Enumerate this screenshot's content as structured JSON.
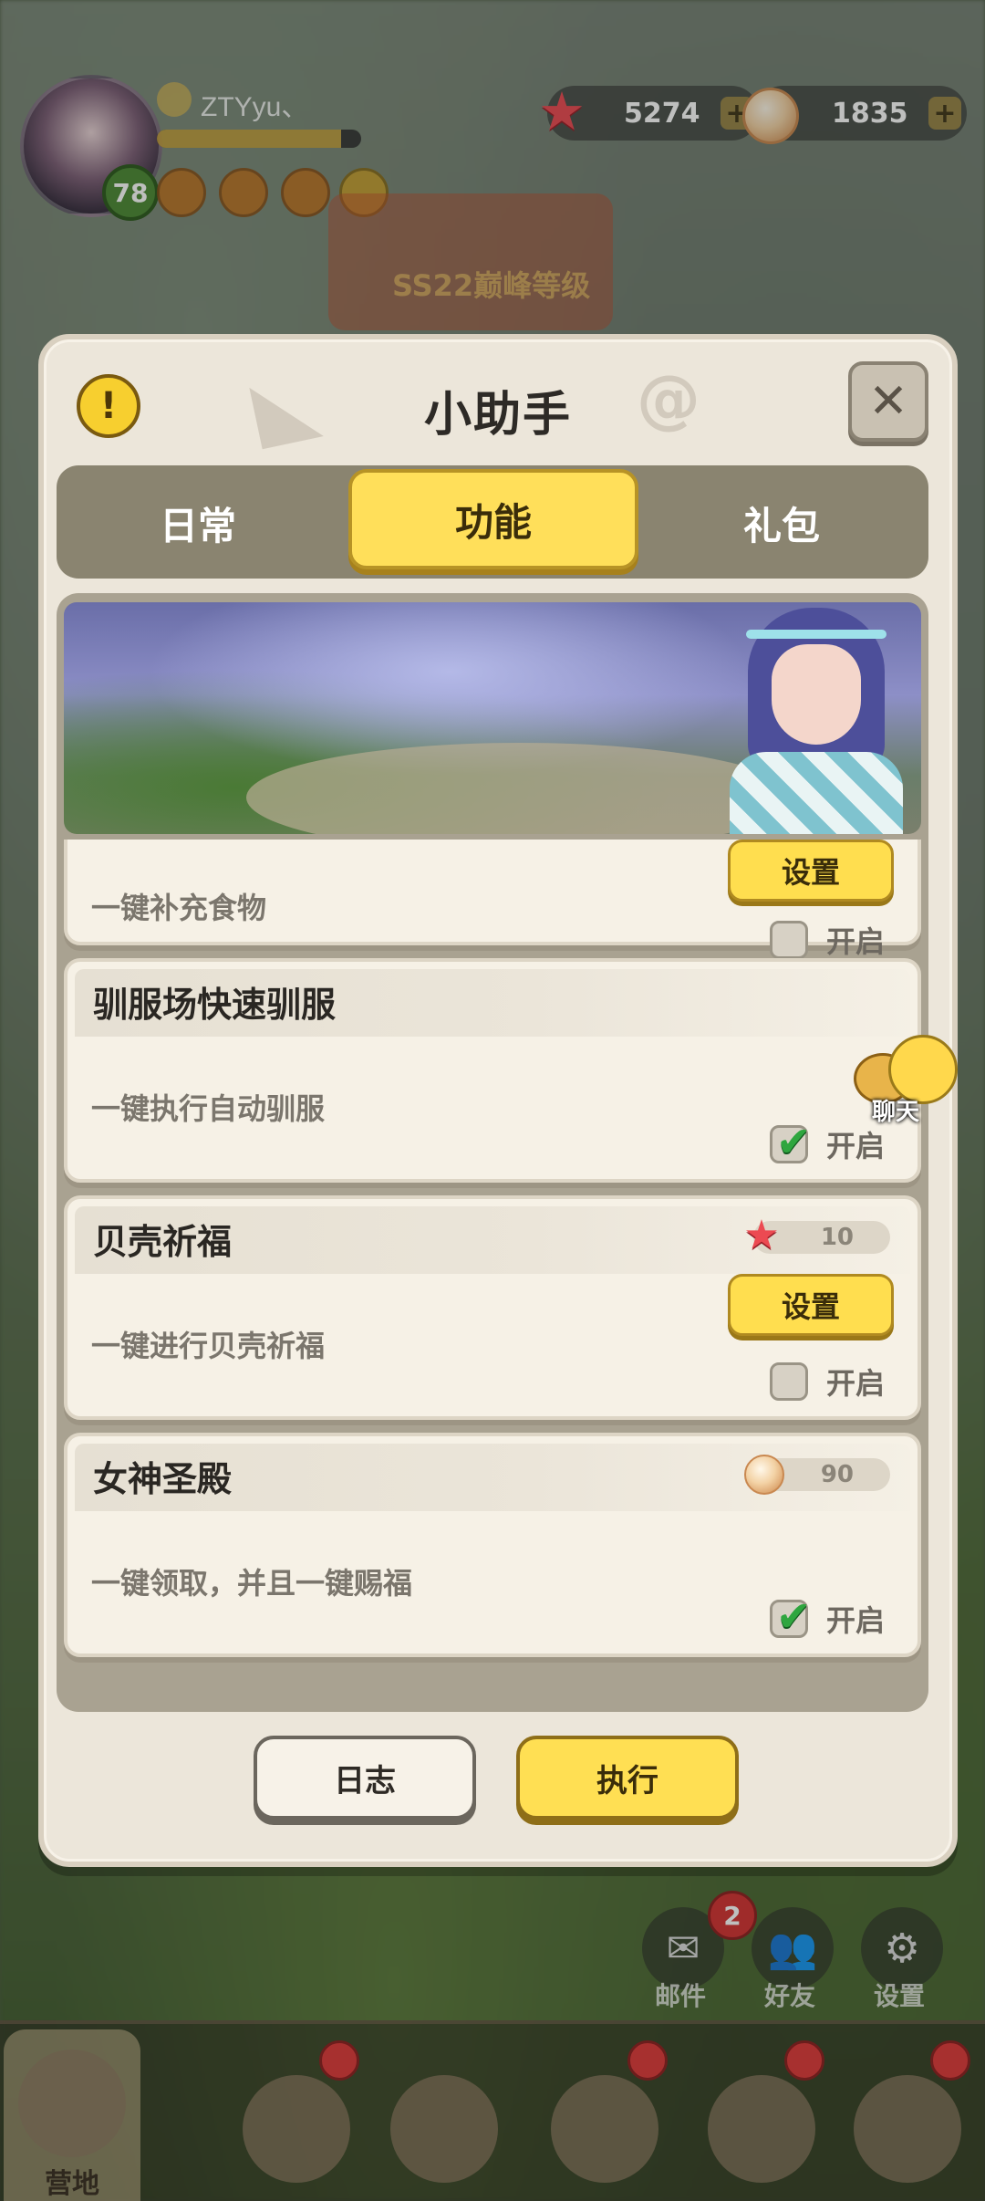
{
  "hud": {
    "username": "ZTYyu、",
    "level": "78",
    "xp_fraction": 0.9,
    "currencies": [
      {
        "icon": "starfish-icon",
        "value": "5274"
      },
      {
        "icon": "pearl-shell-icon",
        "value": "1835"
      }
    ]
  },
  "background": {
    "banner_text": "SS22巅峰等级",
    "mail_badge_count": "2",
    "side_buttons": [
      {
        "icon": "mail-icon",
        "label": "邮件"
      },
      {
        "icon": "friends-icon",
        "label": "好友"
      },
      {
        "icon": "gear-icon",
        "label": "设置"
      }
    ],
    "bottom_nav": [
      {
        "label": "营地",
        "active": true
      }
    ]
  },
  "dialog": {
    "title": "小助手",
    "tabs": [
      {
        "label": "日常",
        "active": false
      },
      {
        "label": "功能",
        "active": true
      },
      {
        "label": "礼包",
        "active": false
      }
    ],
    "cards": [
      {
        "title": "",
        "description": "一键补充食物",
        "setting_label": "设置",
        "toggle_label": "开启",
        "checked": false
      },
      {
        "title": "驯服场快速驯服",
        "description": "一键执行自动驯服",
        "toggle_label": "开启",
        "checked": true
      },
      {
        "title": "贝壳祈福",
        "cost_icon": "starfish-icon",
        "cost": "10",
        "description": "一键进行贝壳祈福",
        "setting_label": "设置",
        "toggle_label": "开启",
        "checked": false
      },
      {
        "title": "女神圣殿",
        "cost_icon": "pearl-shell-icon",
        "cost": "90",
        "description": "一键领取，并且一键赐福",
        "toggle_label": "开启",
        "checked": true
      }
    ],
    "chat_label": "聊天",
    "log_button": "日志",
    "execute_button": "执行"
  },
  "colors": {
    "accent_yellow": "#ffdf5a",
    "panel_bg": "#ece6da",
    "tab_bar": "#8a8470",
    "check_green": "#2fa63f"
  }
}
